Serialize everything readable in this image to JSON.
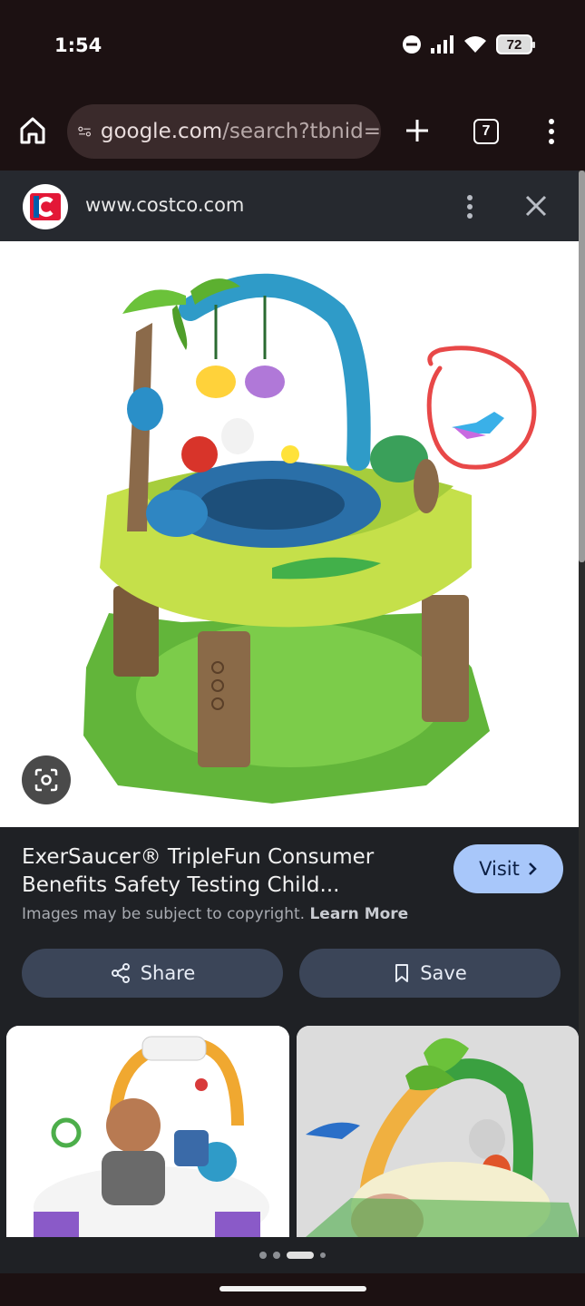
{
  "status_bar": {
    "time": "1:54",
    "battery": "72"
  },
  "browser": {
    "url_host": "google.com",
    "url_path": "/search?tbnid=",
    "tab_count": "7"
  },
  "panel": {
    "site": "www.costco.com"
  },
  "result": {
    "title": "ExerSaucer® TripleFun Consumer Benefits Safety Testing Child...",
    "copyright_text": "Images may be subject to copyright.",
    "learn_more": "Learn More",
    "visit_label": "Visit",
    "share_label": "Share",
    "save_label": "Save"
  },
  "pagination": {
    "total": 4,
    "active": 2
  },
  "colors": {
    "visit_button": "#a8c7fa",
    "action_button": "#3b4558",
    "annotation_circle": "#e84848"
  },
  "icons": [
    "home-icon",
    "site-settings-icon",
    "plus-icon",
    "tab-switcher-icon",
    "more-vert-icon",
    "costco-logo",
    "close-icon",
    "lens-icon",
    "chevron-right-icon",
    "share-icon",
    "bookmark-icon"
  ]
}
